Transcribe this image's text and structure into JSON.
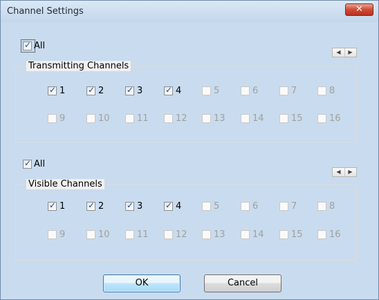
{
  "window": {
    "title": "Channel Settings",
    "close_label": "✕"
  },
  "transmitting": {
    "all_label": "All",
    "all_checked": true,
    "group_title": "Transmitting Channels",
    "channels": [
      {
        "label": "1",
        "checked": true,
        "enabled": true
      },
      {
        "label": "2",
        "checked": true,
        "enabled": true
      },
      {
        "label": "3",
        "checked": true,
        "enabled": true
      },
      {
        "label": "4",
        "checked": true,
        "enabled": true
      },
      {
        "label": "5",
        "checked": false,
        "enabled": false
      },
      {
        "label": "6",
        "checked": false,
        "enabled": false
      },
      {
        "label": "7",
        "checked": false,
        "enabled": false
      },
      {
        "label": "8",
        "checked": false,
        "enabled": false
      },
      {
        "label": "9",
        "checked": false,
        "enabled": false
      },
      {
        "label": "10",
        "checked": false,
        "enabled": false
      },
      {
        "label": "11",
        "checked": false,
        "enabled": false
      },
      {
        "label": "12",
        "checked": false,
        "enabled": false
      },
      {
        "label": "13",
        "checked": false,
        "enabled": false
      },
      {
        "label": "14",
        "checked": false,
        "enabled": false
      },
      {
        "label": "15",
        "checked": false,
        "enabled": false
      },
      {
        "label": "16",
        "checked": false,
        "enabled": false
      }
    ]
  },
  "visible": {
    "all_label": "All",
    "all_checked": true,
    "group_title": "Visible Channels",
    "channels": [
      {
        "label": "1",
        "checked": true,
        "enabled": true
      },
      {
        "label": "2",
        "checked": true,
        "enabled": true
      },
      {
        "label": "3",
        "checked": true,
        "enabled": true
      },
      {
        "label": "4",
        "checked": true,
        "enabled": true
      },
      {
        "label": "5",
        "checked": false,
        "enabled": false
      },
      {
        "label": "6",
        "checked": false,
        "enabled": false
      },
      {
        "label": "7",
        "checked": false,
        "enabled": false
      },
      {
        "label": "8",
        "checked": false,
        "enabled": false
      },
      {
        "label": "9",
        "checked": false,
        "enabled": false
      },
      {
        "label": "10",
        "checked": false,
        "enabled": false
      },
      {
        "label": "11",
        "checked": false,
        "enabled": false
      },
      {
        "label": "12",
        "checked": false,
        "enabled": false
      },
      {
        "label": "13",
        "checked": false,
        "enabled": false
      },
      {
        "label": "14",
        "checked": false,
        "enabled": false
      },
      {
        "label": "15",
        "checked": false,
        "enabled": false
      },
      {
        "label": "16",
        "checked": false,
        "enabled": false
      }
    ]
  },
  "scroll": {
    "left_glyph": "◀",
    "right_glyph": "▶"
  },
  "buttons": {
    "ok": "OK",
    "cancel": "Cancel"
  }
}
